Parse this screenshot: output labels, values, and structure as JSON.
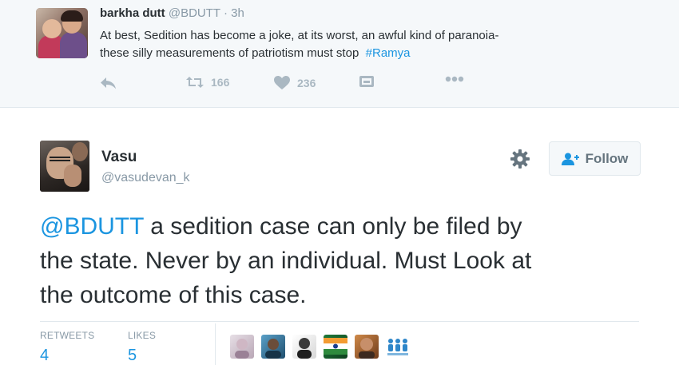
{
  "parent_tweet": {
    "name": "barkha dutt",
    "handle": "@BDUTT",
    "separator": "·",
    "time": "3h",
    "text_line1": "At best, Sedition has become a joke, at its worst, an awful kind of paranoia-",
    "text_line2": "these silly measurements of patriotism must stop",
    "hashtag": "#Ramya",
    "retweet_count": "166",
    "like_count": "236"
  },
  "main_tweet": {
    "name": "Vasu",
    "handle": "@vasudevan_k",
    "follow_label": "Follow",
    "mention": "@BDUTT",
    "text_line1": " a sedition case can only be filed by",
    "text_line2": "the state. Never by an individual. Must Look at",
    "text_line3": "the outcome of this case.",
    "stats": {
      "retweets_label": "RETWEETS",
      "retweets_value": "4",
      "likes_label": "LIKES",
      "likes_value": "5"
    }
  },
  "colors": {
    "link": "#1b95e0",
    "muted": "#8899a6",
    "icon": "#aab8c2",
    "parent_bg": "#f5f8fa"
  },
  "icons": [
    "reply-icon",
    "retweet-icon",
    "heart-icon",
    "media-icon",
    "more-icon",
    "gear-icon",
    "follow-person-icon"
  ]
}
